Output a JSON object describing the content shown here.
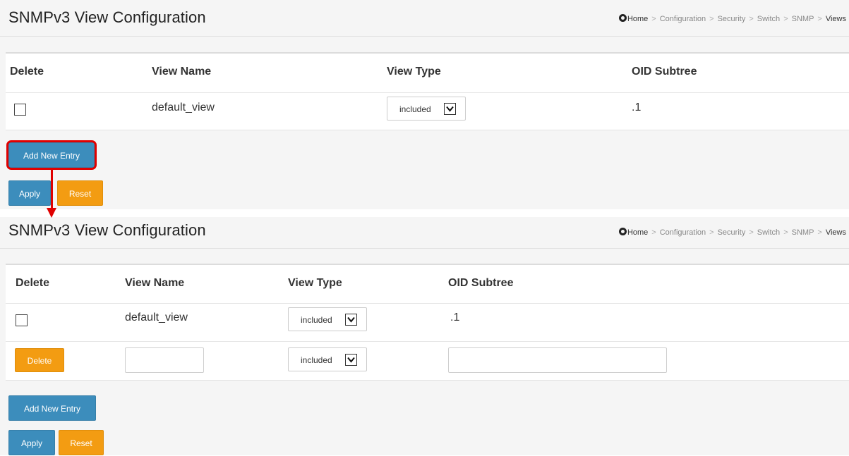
{
  "breadcrumb": {
    "home": "Home",
    "items": [
      "Configuration",
      "Security",
      "Switch",
      "SNMP"
    ],
    "current": "Views",
    "separator": ">"
  },
  "icons": {
    "home": "home-icon",
    "dropdown": "chevron-down-icon"
  },
  "colors": {
    "primary_button": "#3c8dbc",
    "warning_button": "#f39c12",
    "annotation": "#e00000"
  },
  "before": {
    "title": "SNMPv3 View Configuration",
    "columns": [
      "Delete",
      "View Name",
      "View Type",
      "OID Subtree"
    ],
    "rows": [
      {
        "delete_checked": false,
        "view_name": "default_view",
        "view_type": "included",
        "oid_subtree": ".1"
      }
    ],
    "add_button": "Add New Entry",
    "apply_button": "Apply",
    "reset_button": "Reset"
  },
  "after": {
    "title": "SNMPv3 View Configuration",
    "columns": [
      "Delete",
      "View Name",
      "View Type",
      "OID Subtree"
    ],
    "rows": [
      {
        "delete_checked": false,
        "view_name": "default_view",
        "view_type": "included",
        "oid_subtree": ".1"
      }
    ],
    "new_row": {
      "delete_button": "Delete",
      "view_name_value": "",
      "view_type": "included",
      "oid_subtree_value": ""
    },
    "add_button": "Add New Entry",
    "apply_button": "Apply",
    "reset_button": "Reset"
  }
}
